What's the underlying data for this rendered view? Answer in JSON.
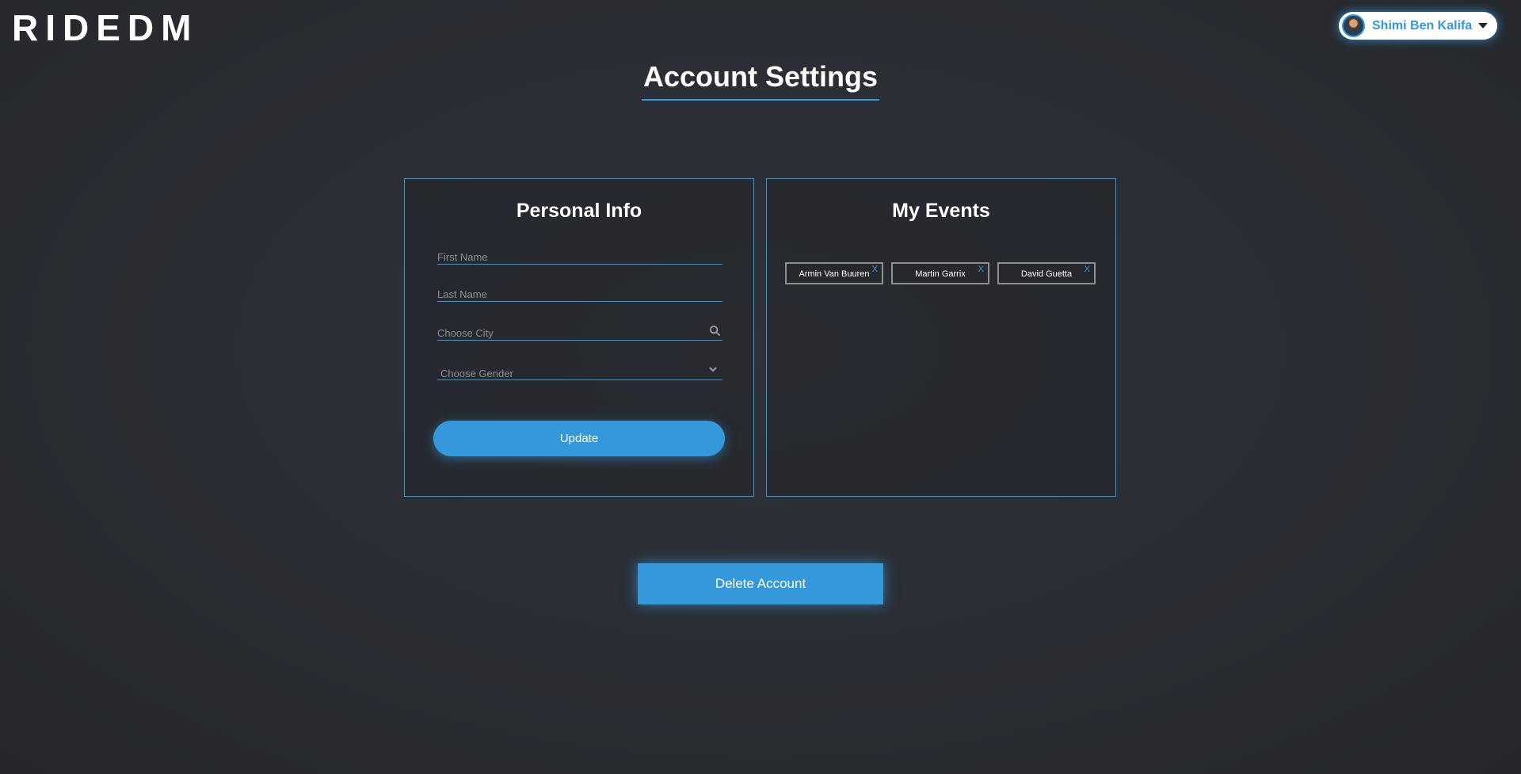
{
  "app": {
    "logo": "RIDEDM"
  },
  "user": {
    "name": "Shimi Ben Kalifa",
    "avatar_icon": "user-avatar",
    "menu_icon": "caret-down-icon"
  },
  "page": {
    "title": "Account Settings"
  },
  "personal_info": {
    "title": "Personal Info",
    "first_name": {
      "placeholder": "First Name",
      "value": ""
    },
    "last_name": {
      "placeholder": "Last Name",
      "value": ""
    },
    "city": {
      "placeholder": "Choose City",
      "value": "",
      "icon": "search-icon"
    },
    "gender": {
      "selected": "Choose Gender",
      "icon": "chevron-down-icon"
    },
    "update_label": "Update"
  },
  "my_events": {
    "title": "My Events",
    "events": [
      {
        "name": "Armin Van Buuren",
        "remove": "X"
      },
      {
        "name": "Martin Garrix",
        "remove": "X"
      },
      {
        "name": "David Guetta",
        "remove": "X"
      }
    ]
  },
  "delete_label": "Delete Account",
  "colors": {
    "accent": "#3498db",
    "background": "#2a2d33",
    "text": "#ffffff"
  }
}
